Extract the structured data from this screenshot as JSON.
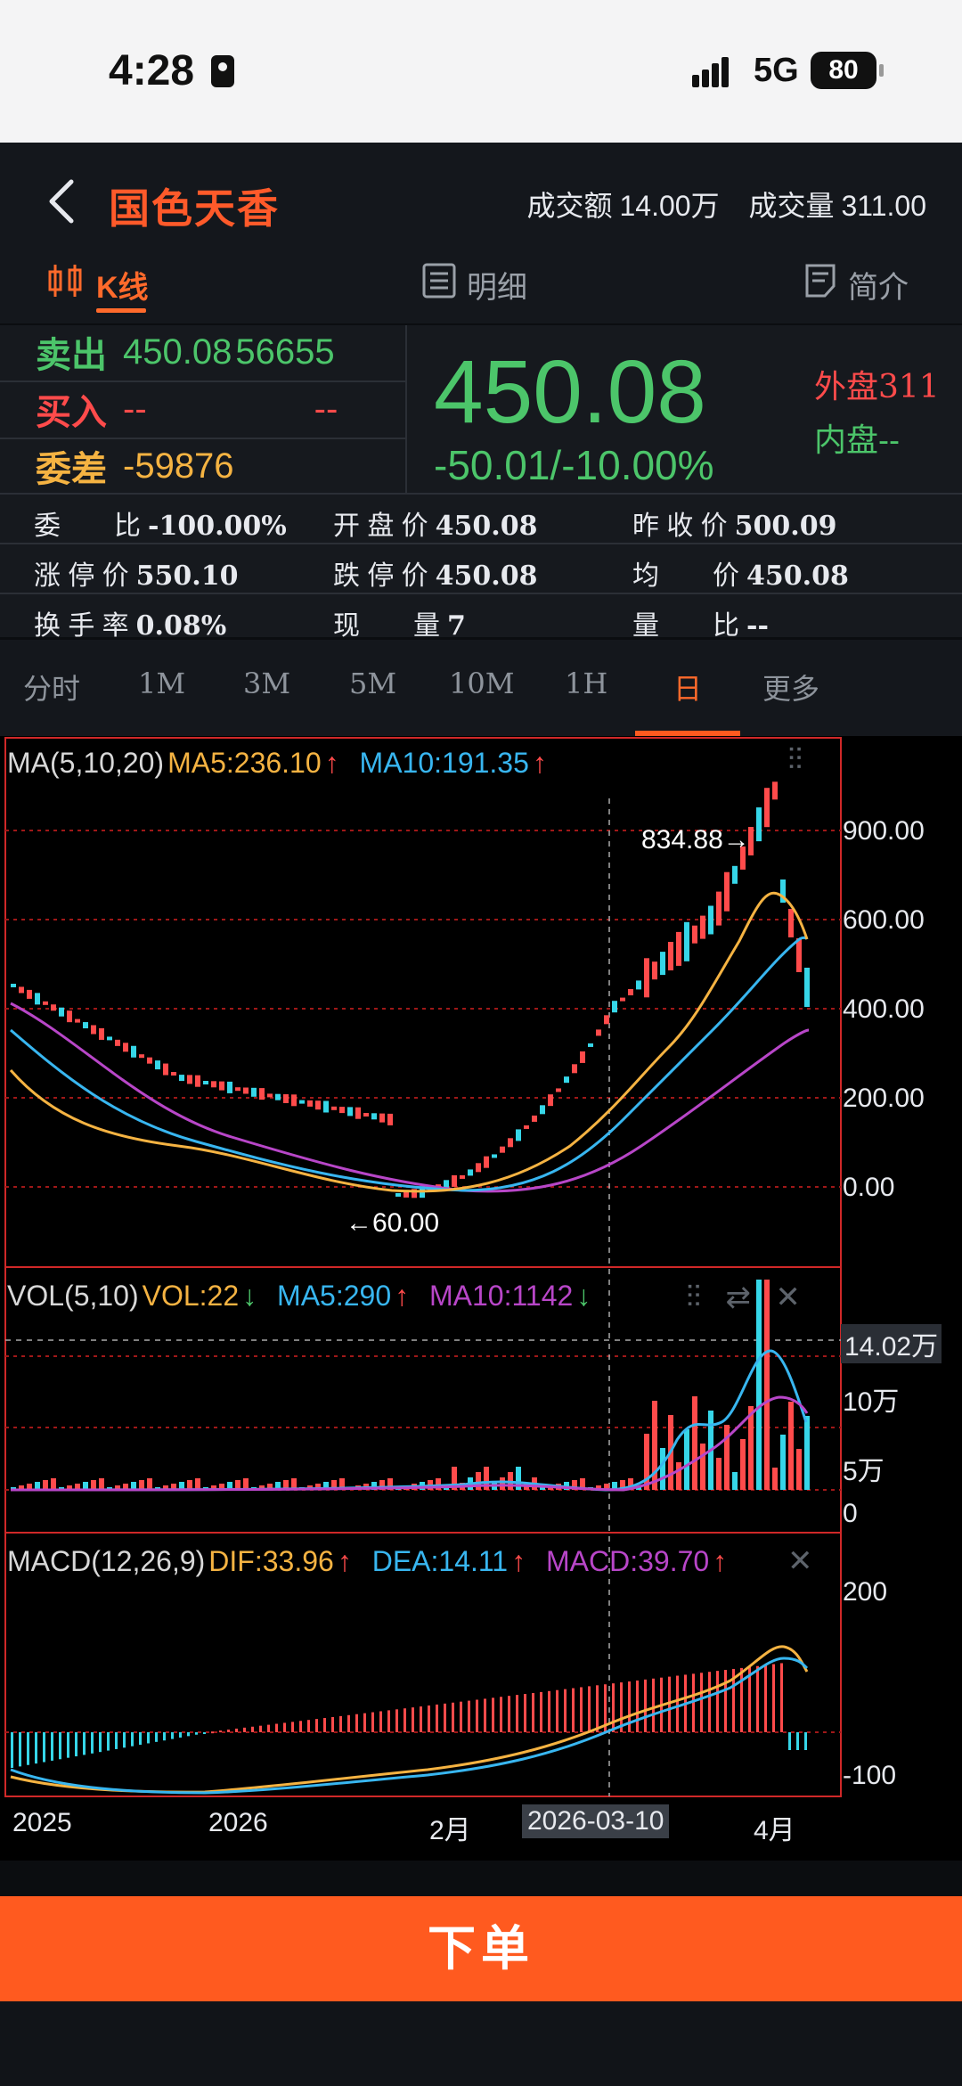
{
  "status": {
    "time": "4:28",
    "network": "5G",
    "battery": "80"
  },
  "header": {
    "stock_name": "国色天香",
    "turnover_label": "成交额",
    "turnover": "14.00万",
    "volume_label": "成交量",
    "volume": "311.00"
  },
  "tabs": [
    {
      "label": "K线"
    },
    {
      "label": "明细"
    },
    {
      "label": "简介"
    }
  ],
  "quote": {
    "sell_label": "卖出",
    "sell_price": "450.08",
    "sell_qty": "56655",
    "buy_label": "买入",
    "buy_price": "--",
    "buy_qty": "--",
    "diff_label": "委差",
    "diff_value": "-59876",
    "price": "450.08",
    "change": "-50.01/-10.00%",
    "outer": "外盘311",
    "inner": "内盘--"
  },
  "info": [
    [
      {
        "label": "委　　比",
        "value": "-100.00%"
      },
      {
        "label": "开 盘 价",
        "value": "450.08"
      },
      {
        "label": "昨 收 价",
        "value": "500.09"
      }
    ],
    [
      {
        "label": "涨 停 价",
        "value": "550.10"
      },
      {
        "label": "跌 停 价",
        "value": "450.08"
      },
      {
        "label": "均　　价",
        "value": "450.08"
      }
    ],
    [
      {
        "label": "换 手 率",
        "value": "0.08%"
      },
      {
        "label": "现　　量",
        "value": "7"
      },
      {
        "label": "量　　比",
        "value": "--"
      }
    ]
  ],
  "periods": [
    "分时",
    "1M",
    "3M",
    "5M",
    "10M",
    "1H",
    "日",
    "更多"
  ],
  "active_period": "日",
  "legends": {
    "ma": {
      "title": "MA(5,10,20)",
      "ma5": "MA5:236.10",
      "ma10": "MA10:191.35",
      "up": "↑"
    },
    "vol": {
      "title": "VOL(5,10)",
      "vol": "VOL:22",
      "ma5": "MA5:290",
      "ma10": "MA10:1142",
      "down": "↓",
      "up": "↑"
    },
    "macd": {
      "title": "MACD(12,26,9)",
      "dif": "DIF:33.96",
      "dea": "DEA:14.11",
      "macd": "MACD:39.70",
      "up": "↑"
    }
  },
  "annotations": {
    "high": "834.88→",
    "low": "←60.00"
  },
  "y_ticks": {
    "price": [
      "900.00",
      "600.00",
      "400.00",
      "200.00",
      "0.00"
    ],
    "vol": [
      "14.02万",
      "10万",
      "5万",
      "0"
    ],
    "macd": [
      "200",
      "-100"
    ]
  },
  "x_ticks": [
    "2025",
    "2026",
    "2月",
    "2026-03-10",
    "4月"
  ],
  "footer": {
    "order_label": "下单"
  },
  "colors": {
    "up": "#ff4b4b",
    "down": "#36d6e8",
    "ma5": "#f5b342",
    "ma10": "#38b6f0",
    "ma20": "#b846c8",
    "accent": "#ff5a1f"
  },
  "chart_data": {
    "type": "candlestick",
    "price_axis": [
      0,
      900
    ],
    "high_marker": 834.88,
    "low_marker": 60.0,
    "ma5": 236.1,
    "ma10": 191.35,
    "vol_max": "14.02万",
    "dif": 33.96,
    "dea": 14.11,
    "macd": 39.7
  }
}
